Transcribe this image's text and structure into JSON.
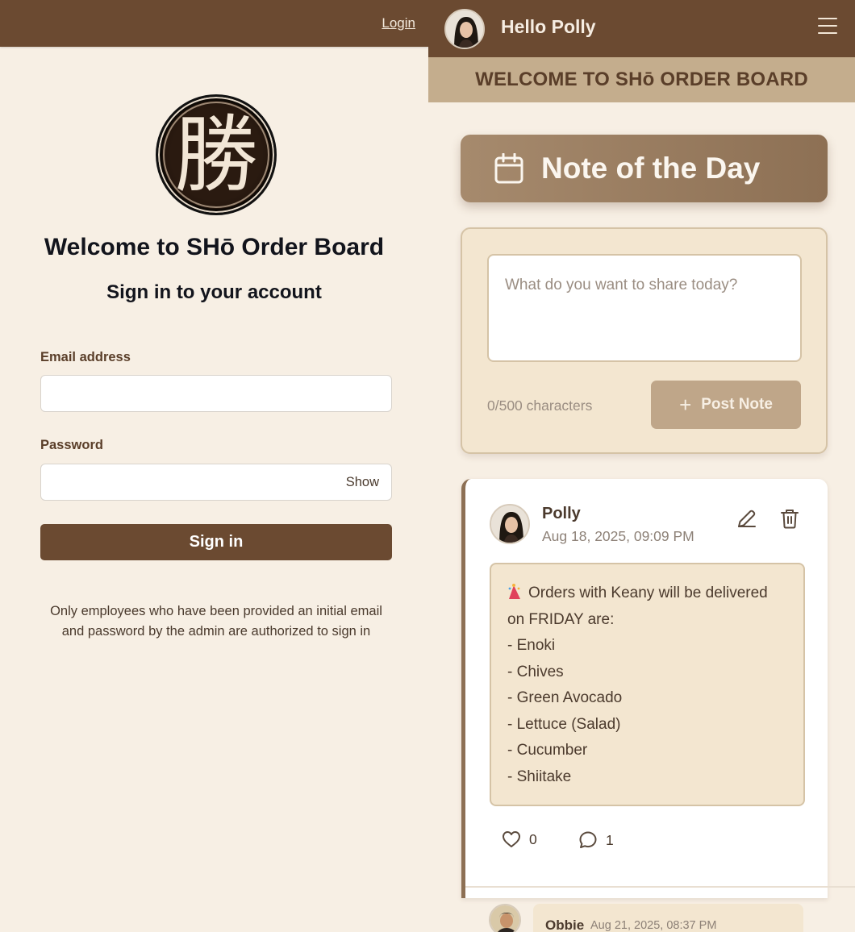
{
  "login_page": {
    "nav_login_label": "Login",
    "logo_char": "勝",
    "title": "Welcome to SHō Order Board",
    "subtitle": "Sign in to your account",
    "email_label": "Email address",
    "email_value": "",
    "password_label": "Password",
    "password_value": "",
    "show_label": "Show",
    "signin_label": "Sign in",
    "disclaimer_line1": "Only employees who have been provided an initial email",
    "disclaimer_line2": "and password by the admin are authorized to sign in"
  },
  "board": {
    "greeting": "Hello Polly",
    "banner": "WELCOME TO SHō ORDER BOARD",
    "section_title": "Note of the Day",
    "compose": {
      "placeholder": "What do you want to share today?",
      "char_count": "0/500 characters",
      "post_label": "Post Note"
    },
    "note": {
      "author": "Polly",
      "timestamp": "Aug 18, 2025, 09:09 PM",
      "lines": [
        "Orders with Keany will be delivered",
        "on FRIDAY are:",
        "- Enoki",
        "- Chives",
        "- Green Avocado",
        "- Lettuce (Salad)",
        "- Cucumber",
        "- Shiitake"
      ],
      "likes": "0",
      "comments": "1"
    },
    "reply": {
      "author": "Obbie",
      "timestamp": "Aug 21, 2025, 08:37 PM"
    }
  },
  "colors": {
    "brown": "#6b4a31",
    "cream": "#f7efe4",
    "tan": "#c4ad8d",
    "card_beige": "#f3e6d0"
  }
}
